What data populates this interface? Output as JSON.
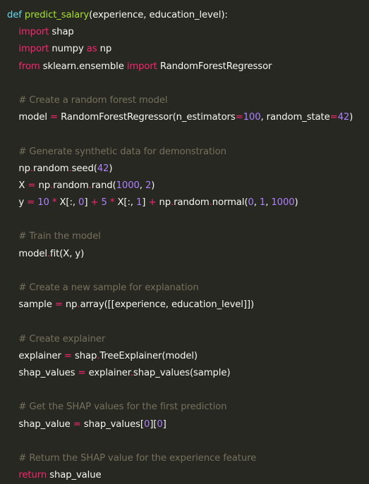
{
  "lines": [
    [
      {
        "t": "def",
        "c": "def"
      },
      {
        "t": " ",
        "c": "tx"
      },
      {
        "t": "predict_salary",
        "c": "fn"
      },
      {
        "t": "(experience, education_level):",
        "c": "tx"
      }
    ],
    [
      {
        "t": "    ",
        "c": "tx"
      },
      {
        "t": "import",
        "c": "kw"
      },
      {
        "t": " shap",
        "c": "tx"
      }
    ],
    [
      {
        "t": "    ",
        "c": "tx"
      },
      {
        "t": "import",
        "c": "kw"
      },
      {
        "t": " numpy ",
        "c": "tx"
      },
      {
        "t": "as",
        "c": "kw"
      },
      {
        "t": " np",
        "c": "tx"
      }
    ],
    [
      {
        "t": "    ",
        "c": "tx"
      },
      {
        "t": "from",
        "c": "kw"
      },
      {
        "t": " sklearn.ensemble ",
        "c": "tx"
      },
      {
        "t": "import",
        "c": "kw"
      },
      {
        "t": " RandomForestRegressor",
        "c": "tx"
      }
    ],
    [],
    [
      {
        "t": "    ",
        "c": "tx"
      },
      {
        "t": "# Create a random forest model",
        "c": "cm"
      }
    ],
    [
      {
        "t": "    model ",
        "c": "tx"
      },
      {
        "t": "=",
        "c": "op"
      },
      {
        "t": " RandomForestRegressor(n_estimators",
        "c": "tx"
      },
      {
        "t": "=",
        "c": "op"
      },
      {
        "t": "100",
        "c": "num"
      },
      {
        "t": ", random_state",
        "c": "tx"
      },
      {
        "t": "=",
        "c": "op"
      },
      {
        "t": "42",
        "c": "num"
      },
      {
        "t": ")",
        "c": "tx"
      }
    ],
    [],
    [
      {
        "t": "    ",
        "c": "tx"
      },
      {
        "t": "# Generate synthetic data for demonstration",
        "c": "cm"
      }
    ],
    [
      {
        "t": "    np",
        "c": "tx"
      },
      {
        "t": ".",
        "c": "op"
      },
      {
        "t": "random",
        "c": "tx"
      },
      {
        "t": ".",
        "c": "op"
      },
      {
        "t": "seed(",
        "c": "tx"
      },
      {
        "t": "42",
        "c": "num"
      },
      {
        "t": ")",
        "c": "tx"
      }
    ],
    [
      {
        "t": "    X ",
        "c": "tx"
      },
      {
        "t": "=",
        "c": "op"
      },
      {
        "t": " np",
        "c": "tx"
      },
      {
        "t": ".",
        "c": "op"
      },
      {
        "t": "random",
        "c": "tx"
      },
      {
        "t": ".",
        "c": "op"
      },
      {
        "t": "rand(",
        "c": "tx"
      },
      {
        "t": "1000",
        "c": "num"
      },
      {
        "t": ", ",
        "c": "tx"
      },
      {
        "t": "2",
        "c": "num"
      },
      {
        "t": ")",
        "c": "tx"
      }
    ],
    [
      {
        "t": "    y ",
        "c": "tx"
      },
      {
        "t": "=",
        "c": "op"
      },
      {
        "t": " ",
        "c": "tx"
      },
      {
        "t": "10",
        "c": "num"
      },
      {
        "t": " ",
        "c": "tx"
      },
      {
        "t": "*",
        "c": "op"
      },
      {
        "t": " X[:, ",
        "c": "tx"
      },
      {
        "t": "0",
        "c": "num"
      },
      {
        "t": "] ",
        "c": "tx"
      },
      {
        "t": "+",
        "c": "op"
      },
      {
        "t": " ",
        "c": "tx"
      },
      {
        "t": "5",
        "c": "num"
      },
      {
        "t": " ",
        "c": "tx"
      },
      {
        "t": "*",
        "c": "op"
      },
      {
        "t": " X[:, ",
        "c": "tx"
      },
      {
        "t": "1",
        "c": "num"
      },
      {
        "t": "] ",
        "c": "tx"
      },
      {
        "t": "+",
        "c": "op"
      },
      {
        "t": " np",
        "c": "tx"
      },
      {
        "t": ".",
        "c": "op"
      },
      {
        "t": "random",
        "c": "tx"
      },
      {
        "t": ".",
        "c": "op"
      },
      {
        "t": "normal(",
        "c": "tx"
      },
      {
        "t": "0",
        "c": "num"
      },
      {
        "t": ", ",
        "c": "tx"
      },
      {
        "t": "1",
        "c": "num"
      },
      {
        "t": ", ",
        "c": "tx"
      },
      {
        "t": "1000",
        "c": "num"
      },
      {
        "t": ")",
        "c": "tx"
      }
    ],
    [],
    [
      {
        "t": "    ",
        "c": "tx"
      },
      {
        "t": "# Train the model",
        "c": "cm"
      }
    ],
    [
      {
        "t": "    model",
        "c": "tx"
      },
      {
        "t": ".",
        "c": "op"
      },
      {
        "t": "fit(X, y)",
        "c": "tx"
      }
    ],
    [],
    [
      {
        "t": "    ",
        "c": "tx"
      },
      {
        "t": "# Create a new sample for explanation",
        "c": "cm"
      }
    ],
    [
      {
        "t": "    sample ",
        "c": "tx"
      },
      {
        "t": "=",
        "c": "op"
      },
      {
        "t": " np",
        "c": "tx"
      },
      {
        "t": ".",
        "c": "op"
      },
      {
        "t": "array([[experience, education_level]])",
        "c": "tx"
      }
    ],
    [],
    [
      {
        "t": "    ",
        "c": "tx"
      },
      {
        "t": "# Create explainer",
        "c": "cm"
      }
    ],
    [
      {
        "t": "    explainer ",
        "c": "tx"
      },
      {
        "t": "=",
        "c": "op"
      },
      {
        "t": " shap",
        "c": "tx"
      },
      {
        "t": ".",
        "c": "op"
      },
      {
        "t": "TreeExplainer(model)",
        "c": "tx"
      }
    ],
    [
      {
        "t": "    shap_values ",
        "c": "tx"
      },
      {
        "t": "=",
        "c": "op"
      },
      {
        "t": " explainer",
        "c": "tx"
      },
      {
        "t": ".",
        "c": "op"
      },
      {
        "t": "shap_values(sample)",
        "c": "tx"
      }
    ],
    [],
    [
      {
        "t": "    ",
        "c": "tx"
      },
      {
        "t": "# Get the SHAP values for the first prediction",
        "c": "cm"
      }
    ],
    [
      {
        "t": "    shap_value ",
        "c": "tx"
      },
      {
        "t": "=",
        "c": "op"
      },
      {
        "t": " shap_values[",
        "c": "tx"
      },
      {
        "t": "0",
        "c": "num"
      },
      {
        "t": "][",
        "c": "tx"
      },
      {
        "t": "0",
        "c": "num"
      },
      {
        "t": "]",
        "c": "tx"
      }
    ],
    [],
    [
      {
        "t": "    ",
        "c": "tx"
      },
      {
        "t": "# Return the SHAP value for the experience feature",
        "c": "cm"
      }
    ],
    [
      {
        "t": "    ",
        "c": "tx"
      },
      {
        "t": "return",
        "c": "kw"
      },
      {
        "t": " shap_value",
        "c": "tx"
      }
    ]
  ],
  "colors": {
    "background": "#272822",
    "keyword": "#f92672",
    "def": "#66d9ef",
    "function": "#a6e22e",
    "number": "#ae81ff",
    "comment": "#75715e",
    "text": "#f8f8f2"
  }
}
